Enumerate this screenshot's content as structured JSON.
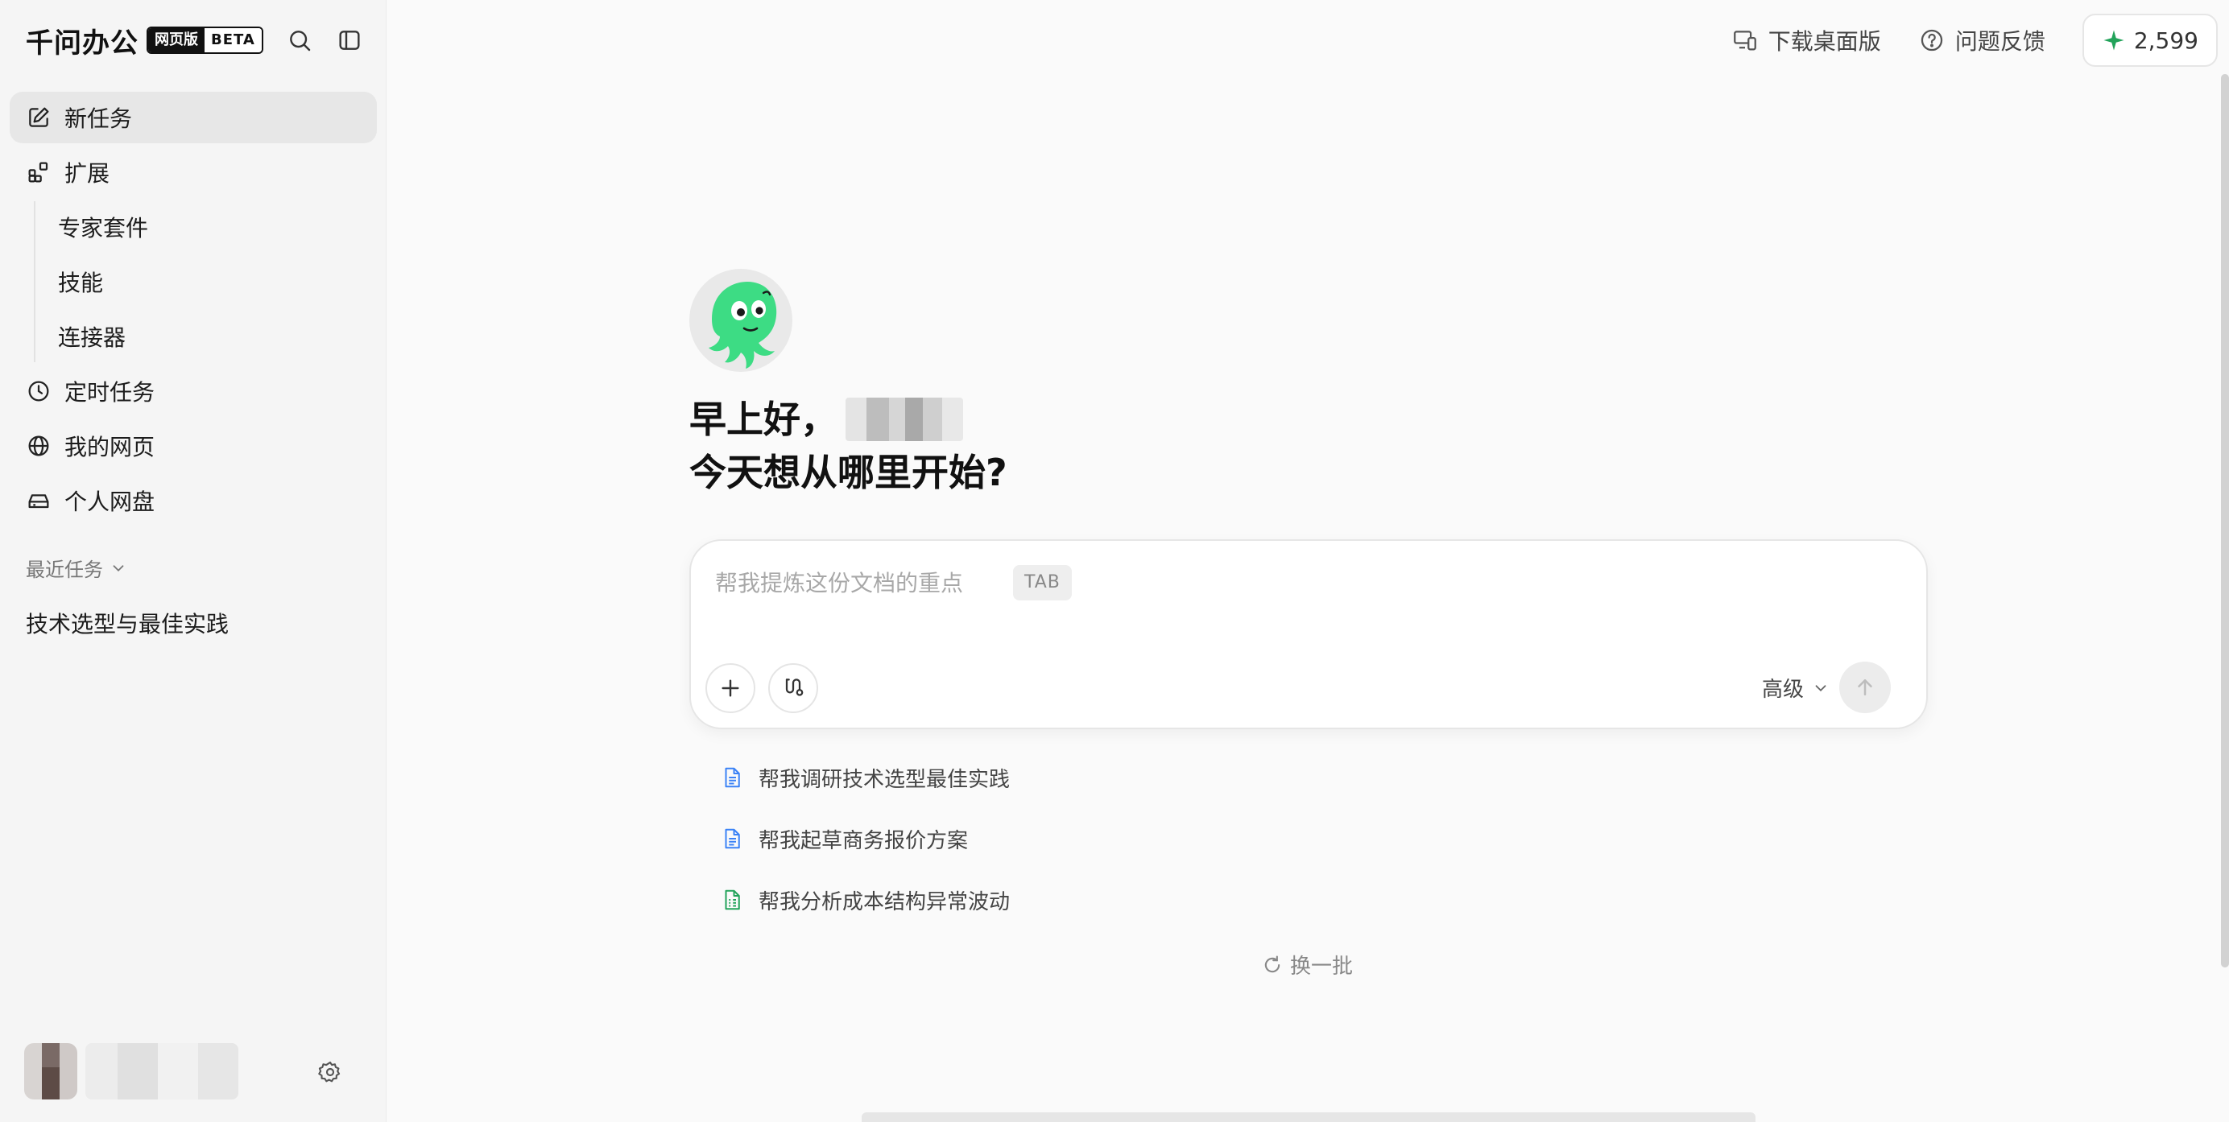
{
  "brand": {
    "name": "千问办公",
    "badge_web": "网页版",
    "badge_beta": "BETA"
  },
  "sidebar": {
    "nav": [
      {
        "label": "新任务",
        "icon": "edit-icon",
        "active": true
      },
      {
        "label": "扩展",
        "icon": "extensions-icon"
      }
    ],
    "sub_items": [
      "专家套件",
      "技能",
      "连接器"
    ],
    "nav2": [
      {
        "label": "定时任务",
        "icon": "clock-icon"
      },
      {
        "label": "我的网页",
        "icon": "globe-icon"
      },
      {
        "label": "个人网盘",
        "icon": "drive-icon"
      }
    ],
    "recent_label": "最近任务",
    "recent_items": [
      "技术选型与最佳实践"
    ]
  },
  "header": {
    "download_label": "下载桌面版",
    "feedback_label": "问题反馈",
    "credits": "2,599"
  },
  "main": {
    "greeting_line1": "早上好，",
    "greeting_line2": "今天想从哪里开始?",
    "input_placeholder": "帮我提炼这份文档的重点",
    "tab_hint": "TAB",
    "advanced_label": "高级",
    "suggestions": [
      {
        "label": "帮我调研技术选型最佳实践",
        "icon": "document-icon",
        "color": "#3b82f6"
      },
      {
        "label": "帮我起草商务报价方案",
        "icon": "document-icon",
        "color": "#3b82f6"
      },
      {
        "label": "帮我分析成本结构异常波动",
        "icon": "spreadsheet-icon",
        "color": "#22a35a"
      }
    ],
    "refresh_label": "换一批"
  },
  "colors": {
    "accent_green": "#22a35a",
    "mascot_green": "#3ddc84",
    "doc_blue": "#3b82f6"
  }
}
